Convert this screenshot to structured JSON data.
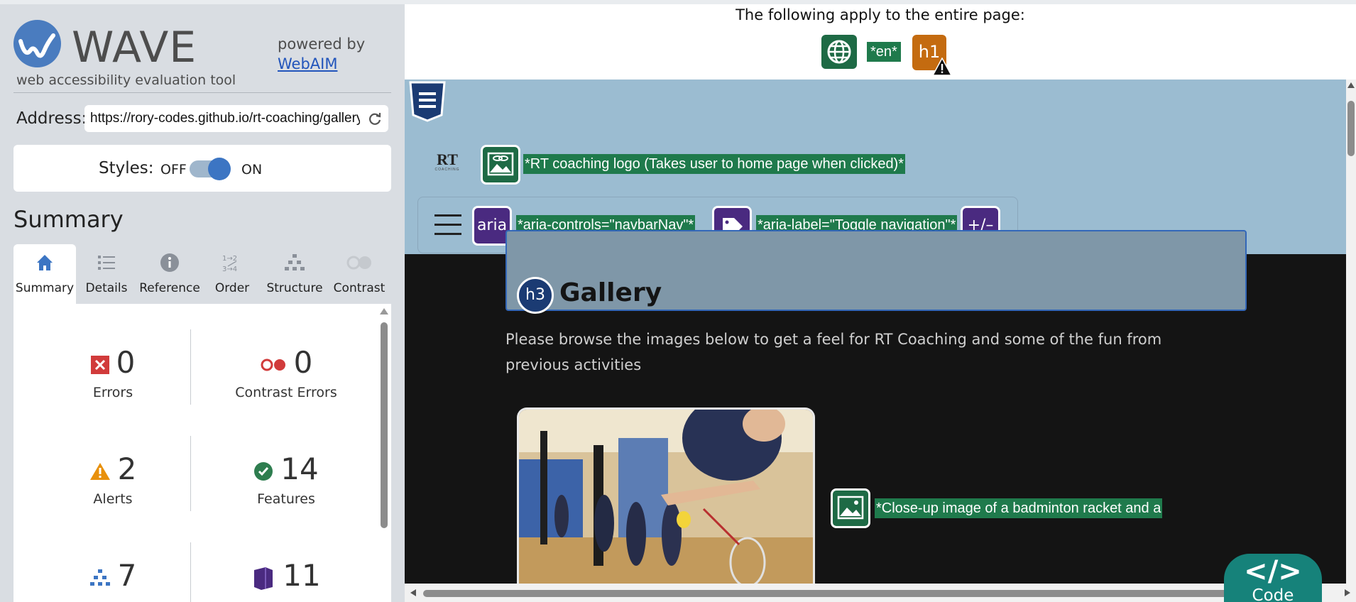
{
  "sidebar": {
    "brand": {
      "title": "WAVE",
      "subtitle": "web accessibility evaluation tool",
      "powered_by": "powered by",
      "webaim_link": "WebAIM",
      "logo_color": "#4a7cbf"
    },
    "address": {
      "label": "Address:",
      "value": "https://rory-codes.github.io/rt-coaching/gallery.html",
      "refresh_icon": "refresh-icon"
    },
    "styles": {
      "label": "Styles:",
      "off_label": "OFF",
      "on_label": "ON",
      "state": "on"
    },
    "summary_heading": "Summary",
    "tabs": [
      {
        "label": "Summary",
        "icon": "home-icon",
        "active": true
      },
      {
        "label": "Details",
        "icon": "list-icon",
        "active": false
      },
      {
        "label": "Reference",
        "icon": "info-icon",
        "active": false
      },
      {
        "label": "Order",
        "icon": "order-icon",
        "active": false
      },
      {
        "label": "Structure",
        "icon": "structure-icon",
        "active": false
      },
      {
        "label": "Contrast",
        "icon": "contrast-icon",
        "active": false
      }
    ],
    "stats": {
      "errors": {
        "value": "0",
        "label": "Errors",
        "color": "#d13b3b"
      },
      "contrast_errors": {
        "value": "0",
        "label": "Contrast Errors",
        "color": "#d13b3b"
      },
      "alerts": {
        "value": "2",
        "label": "Alerts",
        "color": "#e8900c"
      },
      "features": {
        "value": "14",
        "label": "Features",
        "color": "#2e7d4f"
      },
      "structural": {
        "value": "7",
        "color": "#3c75c3"
      },
      "aria": {
        "value": "11",
        "color": "#4a2a80"
      }
    }
  },
  "main": {
    "banner_text": "The following apply to the entire page:",
    "page_icons": {
      "globe": "globe-icon",
      "language": "*en*",
      "heading": "h1"
    },
    "preview": {
      "logo_text": "RT",
      "logo_subtext": "COACHING",
      "logo_alt_label": "*RT coaching logo (Takes user to home page when clicked)*",
      "aria_badge": "aria",
      "aria_controls_label": "*aria-controls=\"navbarNav\"*",
      "aria_label_label": "*aria-label=\"Toggle navigation\"*",
      "expanded_badge": "+/–",
      "h3_badge": "h3",
      "gallery_title": "Gallery",
      "intro": "Please browse the images below to get a feel for RT Coaching and some of the fun from previous activities",
      "photo_alt_label": "*Close-up image of a badminton racket and a"
    },
    "code_tab": {
      "glyph": "</>",
      "label": "Code"
    }
  },
  "colors": {
    "sidebar_bg": "#d9dde2",
    "nav_bg": "#9bbcd1",
    "page_bg": "#141414",
    "feature_green": "#1f7a4c",
    "aria_purple": "#4a2a80",
    "code_teal": "#16827a"
  }
}
